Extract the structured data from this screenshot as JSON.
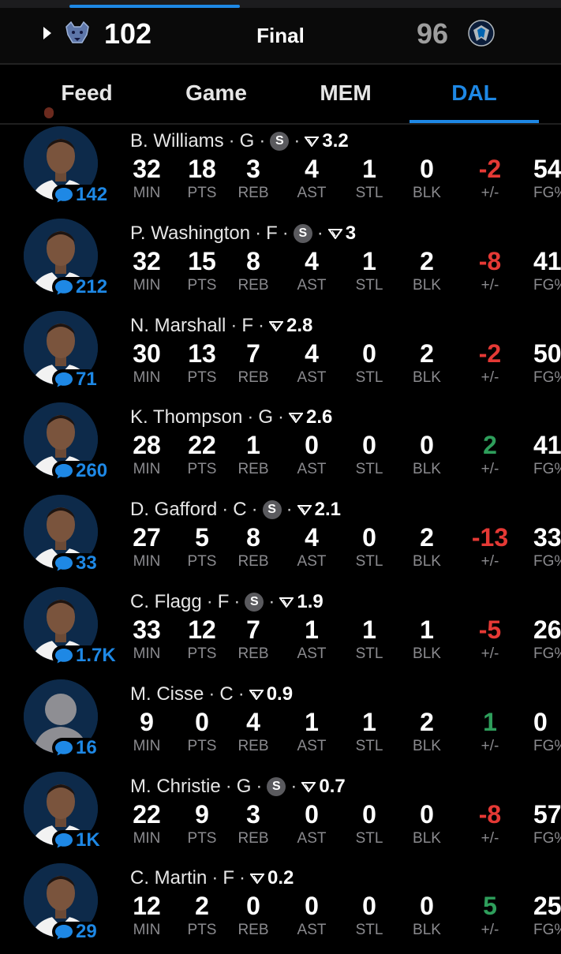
{
  "header": {
    "home_score": "102",
    "status": "Final",
    "away_score": "96",
    "home_team_icon": "grizzlies-logo-icon",
    "away_team_icon": "mavericks-logo-icon"
  },
  "tabs": [
    {
      "label": "Feed",
      "active": false
    },
    {
      "label": "Game",
      "active": false
    },
    {
      "label": "MEM",
      "active": false
    },
    {
      "label": "DAL",
      "active": true
    }
  ],
  "stat_labels": {
    "min": "MIN",
    "pts": "PTS",
    "reb": "REB",
    "ast": "AST",
    "stl": "STL",
    "blk": "BLK",
    "pm": "+/-",
    "fg": "FG%"
  },
  "players": [
    {
      "name": "B. Williams",
      "pos": "G",
      "starter": true,
      "rating": "3.2",
      "comments": "142",
      "min": "32",
      "pts": "18",
      "reb": "3",
      "ast": "4",
      "stl": "1",
      "blk": "0",
      "pm": "-2",
      "fg": "54"
    },
    {
      "name": "P. Washington",
      "pos": "F",
      "starter": true,
      "rating": "3",
      "comments": "212",
      "min": "32",
      "pts": "15",
      "reb": "8",
      "ast": "4",
      "stl": "1",
      "blk": "2",
      "pm": "-8",
      "fg": "41"
    },
    {
      "name": "N. Marshall",
      "pos": "F",
      "starter": false,
      "rating": "2.8",
      "comments": "71",
      "min": "30",
      "pts": "13",
      "reb": "7",
      "ast": "4",
      "stl": "0",
      "blk": "2",
      "pm": "-2",
      "fg": "50"
    },
    {
      "name": "K. Thompson",
      "pos": "G",
      "starter": false,
      "rating": "2.6",
      "comments": "260",
      "min": "28",
      "pts": "22",
      "reb": "1",
      "ast": "0",
      "stl": "0",
      "blk": "0",
      "pm": "2",
      "fg": "41"
    },
    {
      "name": "D. Gafford",
      "pos": "C",
      "starter": true,
      "rating": "2.1",
      "comments": "33",
      "min": "27",
      "pts": "5",
      "reb": "8",
      "ast": "4",
      "stl": "0",
      "blk": "2",
      "pm": "-13",
      "fg": "33"
    },
    {
      "name": "C. Flagg",
      "pos": "F",
      "starter": true,
      "rating": "1.9",
      "comments": "1.7K",
      "min": "33",
      "pts": "12",
      "reb": "7",
      "ast": "1",
      "stl": "1",
      "blk": "1",
      "pm": "-5",
      "fg": "26"
    },
    {
      "name": "M. Cisse",
      "pos": "C",
      "starter": false,
      "rating": "0.9",
      "comments": "16",
      "min": "9",
      "pts": "0",
      "reb": "4",
      "ast": "1",
      "stl": "1",
      "blk": "2",
      "pm": "1",
      "fg": "0"
    },
    {
      "name": "M. Christie",
      "pos": "G",
      "starter": true,
      "rating": "0.7",
      "comments": "1K",
      "min": "22",
      "pts": "9",
      "reb": "3",
      "ast": "0",
      "stl": "0",
      "blk": "0",
      "pm": "-8",
      "fg": "57"
    },
    {
      "name": "C. Martin",
      "pos": "F",
      "starter": false,
      "rating": "0.2",
      "comments": "29",
      "min": "12",
      "pts": "2",
      "reb": "0",
      "ast": "0",
      "stl": "0",
      "blk": "0",
      "pm": "5",
      "fg": "25"
    }
  ],
  "starter_label": "S",
  "colors": {
    "accent": "#1e88e5",
    "negative": "#e53935",
    "positive": "#2e9e5b",
    "muted": "#8a8a8e"
  }
}
